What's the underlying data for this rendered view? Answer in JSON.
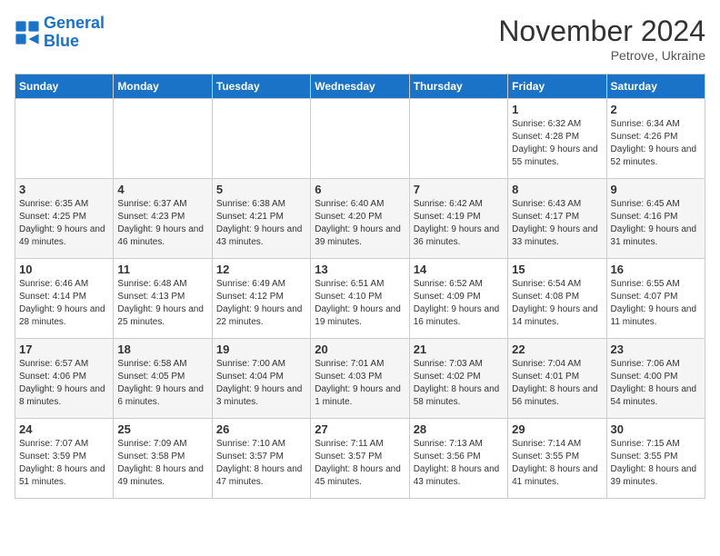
{
  "logo": {
    "line1": "General",
    "line2": "Blue"
  },
  "title": "November 2024",
  "subtitle": "Petrove, Ukraine",
  "weekdays": [
    "Sunday",
    "Monday",
    "Tuesday",
    "Wednesday",
    "Thursday",
    "Friday",
    "Saturday"
  ],
  "weeks": [
    [
      {
        "day": "",
        "info": ""
      },
      {
        "day": "",
        "info": ""
      },
      {
        "day": "",
        "info": ""
      },
      {
        "day": "",
        "info": ""
      },
      {
        "day": "",
        "info": ""
      },
      {
        "day": "1",
        "info": "Sunrise: 6:32 AM\nSunset: 4:28 PM\nDaylight: 9 hours and 55 minutes."
      },
      {
        "day": "2",
        "info": "Sunrise: 6:34 AM\nSunset: 4:26 PM\nDaylight: 9 hours and 52 minutes."
      }
    ],
    [
      {
        "day": "3",
        "info": "Sunrise: 6:35 AM\nSunset: 4:25 PM\nDaylight: 9 hours and 49 minutes."
      },
      {
        "day": "4",
        "info": "Sunrise: 6:37 AM\nSunset: 4:23 PM\nDaylight: 9 hours and 46 minutes."
      },
      {
        "day": "5",
        "info": "Sunrise: 6:38 AM\nSunset: 4:21 PM\nDaylight: 9 hours and 43 minutes."
      },
      {
        "day": "6",
        "info": "Sunrise: 6:40 AM\nSunset: 4:20 PM\nDaylight: 9 hours and 39 minutes."
      },
      {
        "day": "7",
        "info": "Sunrise: 6:42 AM\nSunset: 4:19 PM\nDaylight: 9 hours and 36 minutes."
      },
      {
        "day": "8",
        "info": "Sunrise: 6:43 AM\nSunset: 4:17 PM\nDaylight: 9 hours and 33 minutes."
      },
      {
        "day": "9",
        "info": "Sunrise: 6:45 AM\nSunset: 4:16 PM\nDaylight: 9 hours and 31 minutes."
      }
    ],
    [
      {
        "day": "10",
        "info": "Sunrise: 6:46 AM\nSunset: 4:14 PM\nDaylight: 9 hours and 28 minutes."
      },
      {
        "day": "11",
        "info": "Sunrise: 6:48 AM\nSunset: 4:13 PM\nDaylight: 9 hours and 25 minutes."
      },
      {
        "day": "12",
        "info": "Sunrise: 6:49 AM\nSunset: 4:12 PM\nDaylight: 9 hours and 22 minutes."
      },
      {
        "day": "13",
        "info": "Sunrise: 6:51 AM\nSunset: 4:10 PM\nDaylight: 9 hours and 19 minutes."
      },
      {
        "day": "14",
        "info": "Sunrise: 6:52 AM\nSunset: 4:09 PM\nDaylight: 9 hours and 16 minutes."
      },
      {
        "day": "15",
        "info": "Sunrise: 6:54 AM\nSunset: 4:08 PM\nDaylight: 9 hours and 14 minutes."
      },
      {
        "day": "16",
        "info": "Sunrise: 6:55 AM\nSunset: 4:07 PM\nDaylight: 9 hours and 11 minutes."
      }
    ],
    [
      {
        "day": "17",
        "info": "Sunrise: 6:57 AM\nSunset: 4:06 PM\nDaylight: 9 hours and 8 minutes."
      },
      {
        "day": "18",
        "info": "Sunrise: 6:58 AM\nSunset: 4:05 PM\nDaylight: 9 hours and 6 minutes."
      },
      {
        "day": "19",
        "info": "Sunrise: 7:00 AM\nSunset: 4:04 PM\nDaylight: 9 hours and 3 minutes."
      },
      {
        "day": "20",
        "info": "Sunrise: 7:01 AM\nSunset: 4:03 PM\nDaylight: 9 hours and 1 minute."
      },
      {
        "day": "21",
        "info": "Sunrise: 7:03 AM\nSunset: 4:02 PM\nDaylight: 8 hours and 58 minutes."
      },
      {
        "day": "22",
        "info": "Sunrise: 7:04 AM\nSunset: 4:01 PM\nDaylight: 8 hours and 56 minutes."
      },
      {
        "day": "23",
        "info": "Sunrise: 7:06 AM\nSunset: 4:00 PM\nDaylight: 8 hours and 54 minutes."
      }
    ],
    [
      {
        "day": "24",
        "info": "Sunrise: 7:07 AM\nSunset: 3:59 PM\nDaylight: 8 hours and 51 minutes."
      },
      {
        "day": "25",
        "info": "Sunrise: 7:09 AM\nSunset: 3:58 PM\nDaylight: 8 hours and 49 minutes."
      },
      {
        "day": "26",
        "info": "Sunrise: 7:10 AM\nSunset: 3:57 PM\nDaylight: 8 hours and 47 minutes."
      },
      {
        "day": "27",
        "info": "Sunrise: 7:11 AM\nSunset: 3:57 PM\nDaylight: 8 hours and 45 minutes."
      },
      {
        "day": "28",
        "info": "Sunrise: 7:13 AM\nSunset: 3:56 PM\nDaylight: 8 hours and 43 minutes."
      },
      {
        "day": "29",
        "info": "Sunrise: 7:14 AM\nSunset: 3:55 PM\nDaylight: 8 hours and 41 minutes."
      },
      {
        "day": "30",
        "info": "Sunrise: 7:15 AM\nSunset: 3:55 PM\nDaylight: 8 hours and 39 minutes."
      }
    ]
  ]
}
